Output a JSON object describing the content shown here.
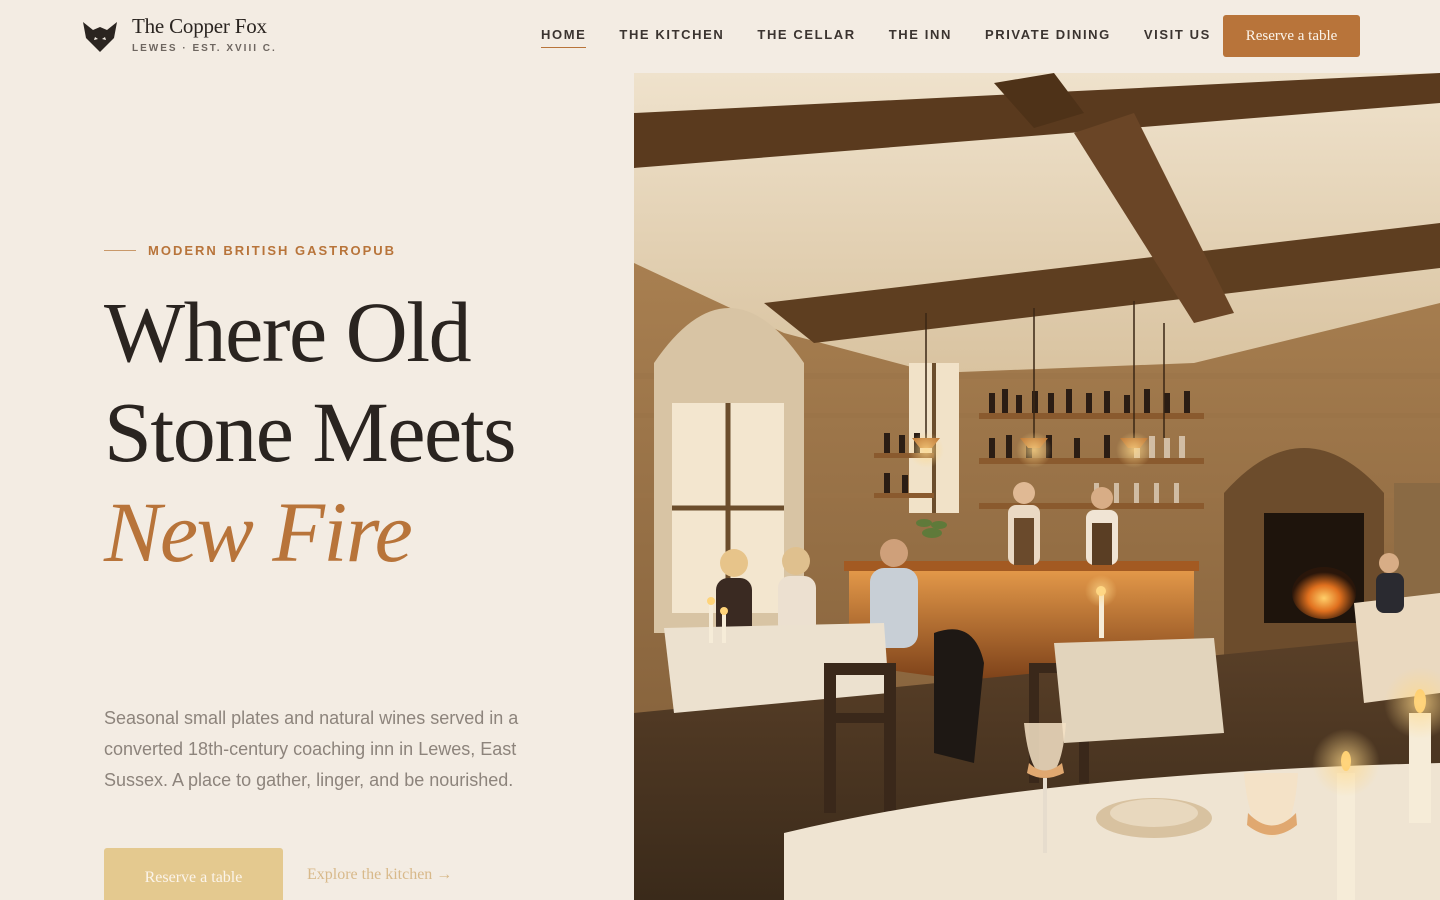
{
  "brand": {
    "name": "The Copper Fox",
    "subtitle": "LEWES · EST. XVIII C.",
    "logo_icon": "fox-head-icon"
  },
  "nav": {
    "items": [
      {
        "label": "HOME",
        "active": true
      },
      {
        "label": "THE KITCHEN",
        "active": false
      },
      {
        "label": "THE CELLAR",
        "active": false
      },
      {
        "label": "THE INN",
        "active": false
      },
      {
        "label": "PRIVATE DINING",
        "active": false
      },
      {
        "label": "VISIT US",
        "active": false
      }
    ],
    "reserve_label": "Reserve a table"
  },
  "hero": {
    "eyebrow": "MODERN BRITISH GASTROPUB",
    "headline_plain": "Where Old Stone Meets",
    "headline_accent": "New Fire",
    "description": "Seasonal small plates and natural wines served in a converted 18th-century coaching inn in Lewes, East Sussex. A place to gather, linger, and be nourished.",
    "cta_primary": "Reserve a table",
    "cta_secondary": "Explore the kitchen →"
  },
  "colors": {
    "background": "#f3ece3",
    "accent": "#b8743a",
    "text": "#2a2420",
    "muted": "#8d847c"
  }
}
